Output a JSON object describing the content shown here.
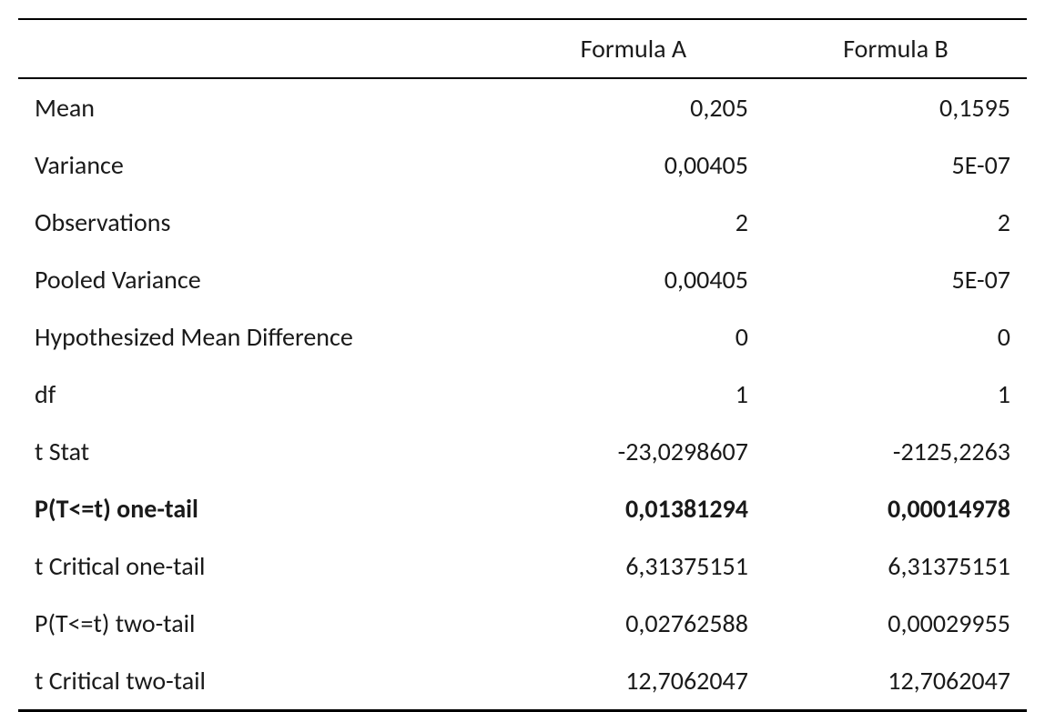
{
  "table": {
    "headers": {
      "blank": "",
      "col1": "Formula A",
      "col2": "Formula B"
    },
    "rows": [
      {
        "label": "Mean",
        "a": "0,205",
        "b": "0,1595",
        "bold": false
      },
      {
        "label": "Variance",
        "a": "0,00405",
        "b": "5E-07",
        "bold": false
      },
      {
        "label": "Observations",
        "a": "2",
        "b": "2",
        "bold": false
      },
      {
        "label": "Pooled Variance",
        "a": "0,00405",
        "b": "5E-07",
        "bold": false
      },
      {
        "label": "Hypothesized Mean Difference",
        "a": "0",
        "b": "0",
        "bold": false
      },
      {
        "label": "df",
        "a": "1",
        "b": "1",
        "bold": false
      },
      {
        "label": "t Stat",
        "a": "-23,0298607",
        "b": "-2125,2263",
        "bold": false
      },
      {
        "label": "P(T<=t) one-tail",
        "a": "0,01381294",
        "b": "0,00014978",
        "bold": true
      },
      {
        "label": "t Critical one-tail",
        "a": "6,31375151",
        "b": "6,31375151",
        "bold": false
      },
      {
        "label": "P(T<=t) two-tail",
        "a": "0,02762588",
        "b": "0,00029955",
        "bold": false
      },
      {
        "label": "t Critical two-tail",
        "a": "12,7062047",
        "b": "12,7062047",
        "bold": false
      }
    ]
  }
}
